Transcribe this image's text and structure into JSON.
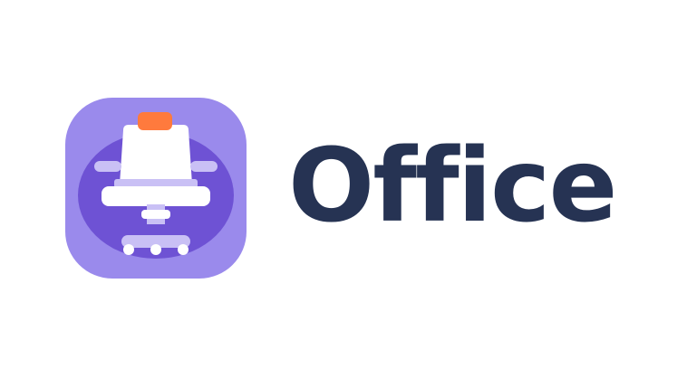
{
  "brand": {
    "name": "Office",
    "icon": "office-chair-icon",
    "colors": {
      "text": "#263353",
      "icon_background": "#9A8AEC",
      "icon_circle": "#6E52D4",
      "chair": "#FFFFFF",
      "chair_accent": "#C9C0F5",
      "headrest": "#FF7A3D"
    }
  }
}
